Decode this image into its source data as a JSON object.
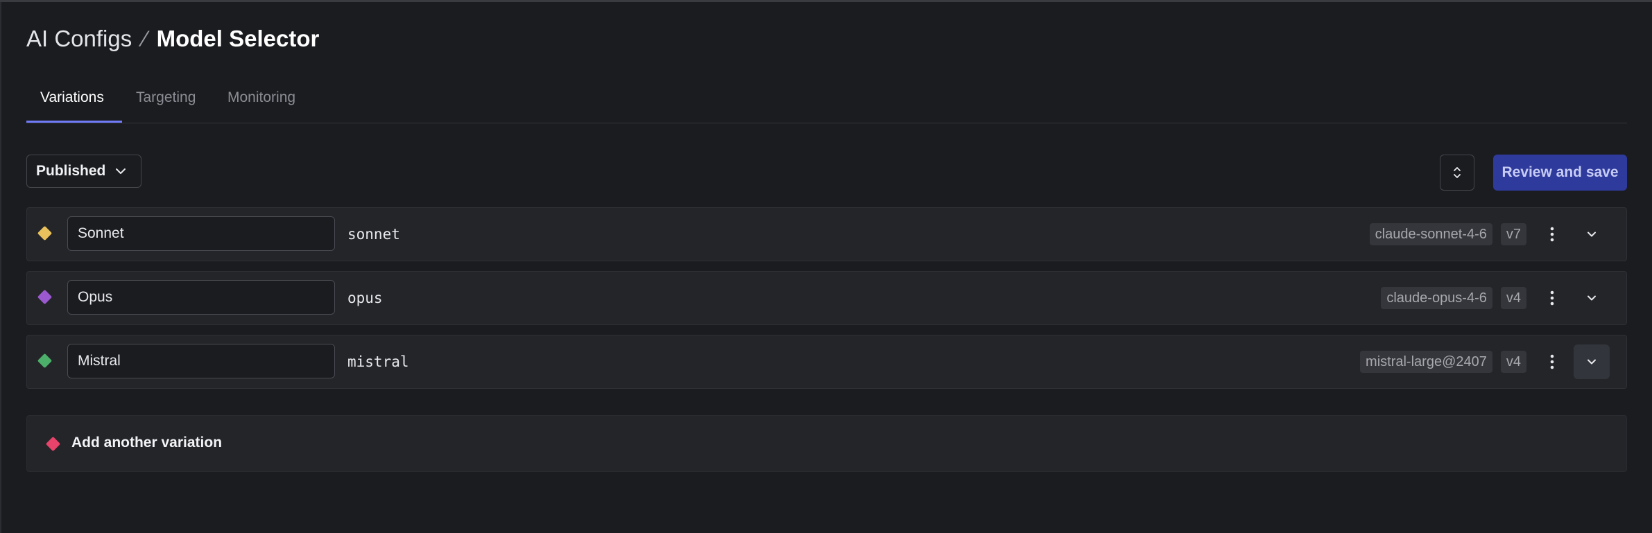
{
  "breadcrumb": {
    "parent": "AI Configs",
    "separator": "⁄",
    "current": "Model Selector"
  },
  "tabs": [
    {
      "label": "Variations",
      "active": true
    },
    {
      "label": "Targeting",
      "active": false
    },
    {
      "label": "Monitoring",
      "active": false
    }
  ],
  "toolbar": {
    "status_selected": "Published",
    "sort_icon": "chevron-up-down-icon",
    "review_label": "Review and save"
  },
  "variations": [
    {
      "name": "Sonnet",
      "key": "sonnet",
      "model": "claude-sonnet-4-6",
      "version": "v7",
      "color": "#e8c15c"
    },
    {
      "name": "Opus",
      "key": "opus",
      "model": "claude-opus-4-6",
      "version": "v4",
      "color": "#9b59d0"
    },
    {
      "name": "Mistral",
      "key": "mistral",
      "model": "mistral-large@2407",
      "version": "v4",
      "color": "#4caf6a"
    }
  ],
  "add_variation": {
    "label": "Add another variation",
    "color": "#e8436a"
  }
}
